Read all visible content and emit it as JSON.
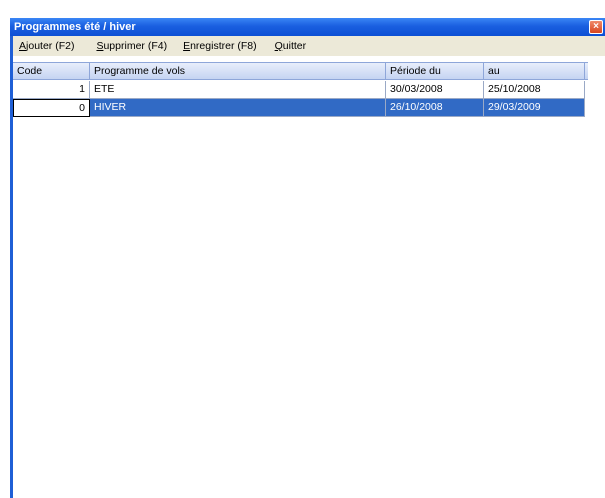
{
  "window": {
    "title": "Programmes été / hiver",
    "close_glyph": "×"
  },
  "menu": [
    {
      "accel": "A",
      "rest": "jouter (F2)"
    },
    {
      "accel": "S",
      "rest": "upprimer (F4)"
    },
    {
      "accel": "E",
      "rest": "nregistrer (F8)"
    },
    {
      "accel": "Q",
      "rest": "uitter"
    }
  ],
  "grid": {
    "columns": [
      "Code",
      "Programme de vols",
      "Période du",
      "au"
    ],
    "rows": [
      {
        "code": "1",
        "programme": "ETE",
        "from": "30/03/2008",
        "to": "25/10/2008",
        "selected": false
      },
      {
        "code": "0",
        "programme": "HIVER",
        "from": "26/10/2008",
        "to": "29/03/2009",
        "selected": true
      }
    ]
  },
  "colors": {
    "titlebar": "#0c4fd4",
    "selection": "#316ac5",
    "menubar": "#ece9d8"
  }
}
